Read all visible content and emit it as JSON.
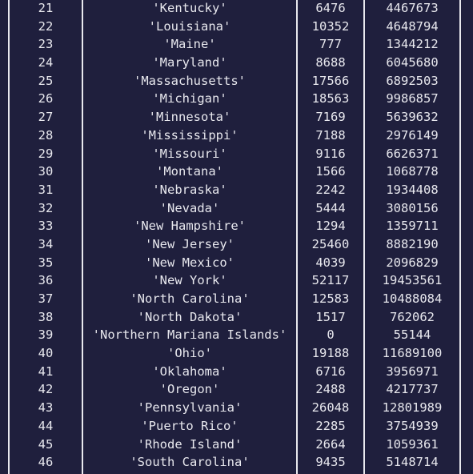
{
  "table": {
    "rows": [
      {
        "idx": "21",
        "state": "'Kentucky'",
        "a": "6476",
        "b": "4467673"
      },
      {
        "idx": "22",
        "state": "'Louisiana'",
        "a": "10352",
        "b": "4648794"
      },
      {
        "idx": "23",
        "state": "'Maine'",
        "a": "777",
        "b": "1344212"
      },
      {
        "idx": "24",
        "state": "'Maryland'",
        "a": "8688",
        "b": "6045680"
      },
      {
        "idx": "25",
        "state": "'Massachusetts'",
        "a": "17566",
        "b": "6892503"
      },
      {
        "idx": "26",
        "state": "'Michigan'",
        "a": "18563",
        "b": "9986857"
      },
      {
        "idx": "27",
        "state": "'Minnesota'",
        "a": "7169",
        "b": "5639632"
      },
      {
        "idx": "28",
        "state": "'Mississippi'",
        "a": "7188",
        "b": "2976149"
      },
      {
        "idx": "29",
        "state": "'Missouri'",
        "a": "9116",
        "b": "6626371"
      },
      {
        "idx": "30",
        "state": "'Montana'",
        "a": "1566",
        "b": "1068778"
      },
      {
        "idx": "31",
        "state": "'Nebraska'",
        "a": "2242",
        "b": "1934408"
      },
      {
        "idx": "32",
        "state": "'Nevada'",
        "a": "5444",
        "b": "3080156"
      },
      {
        "idx": "33",
        "state": "'New Hampshire'",
        "a": "1294",
        "b": "1359711"
      },
      {
        "idx": "34",
        "state": "'New Jersey'",
        "a": "25460",
        "b": "8882190"
      },
      {
        "idx": "35",
        "state": "'New Mexico'",
        "a": "4039",
        "b": "2096829"
      },
      {
        "idx": "36",
        "state": "'New York'",
        "a": "52117",
        "b": "19453561"
      },
      {
        "idx": "37",
        "state": "'North Carolina'",
        "a": "12583",
        "b": "10488084"
      },
      {
        "idx": "38",
        "state": "'North Dakota'",
        "a": "1517",
        "b": "762062"
      },
      {
        "idx": "39",
        "state": "'Northern Mariana Islands'",
        "a": "0",
        "b": "55144"
      },
      {
        "idx": "40",
        "state": "'Ohio'",
        "a": "19188",
        "b": "11689100"
      },
      {
        "idx": "41",
        "state": "'Oklahoma'",
        "a": "6716",
        "b": "3956971"
      },
      {
        "idx": "42",
        "state": "'Oregon'",
        "a": "2488",
        "b": "4217737"
      },
      {
        "idx": "43",
        "state": "'Pennsylvania'",
        "a": "26048",
        "b": "12801989"
      },
      {
        "idx": "44",
        "state": "'Puerto Rico'",
        "a": "2285",
        "b": "3754939"
      },
      {
        "idx": "45",
        "state": "'Rhode Island'",
        "a": "2664",
        "b": "1059361"
      },
      {
        "idx": "46",
        "state": "'South Carolina'",
        "a": "9435",
        "b": "5148714"
      }
    ]
  },
  "colors": {
    "background": "#1f1f3d",
    "foreground": "#e8e8ee"
  }
}
